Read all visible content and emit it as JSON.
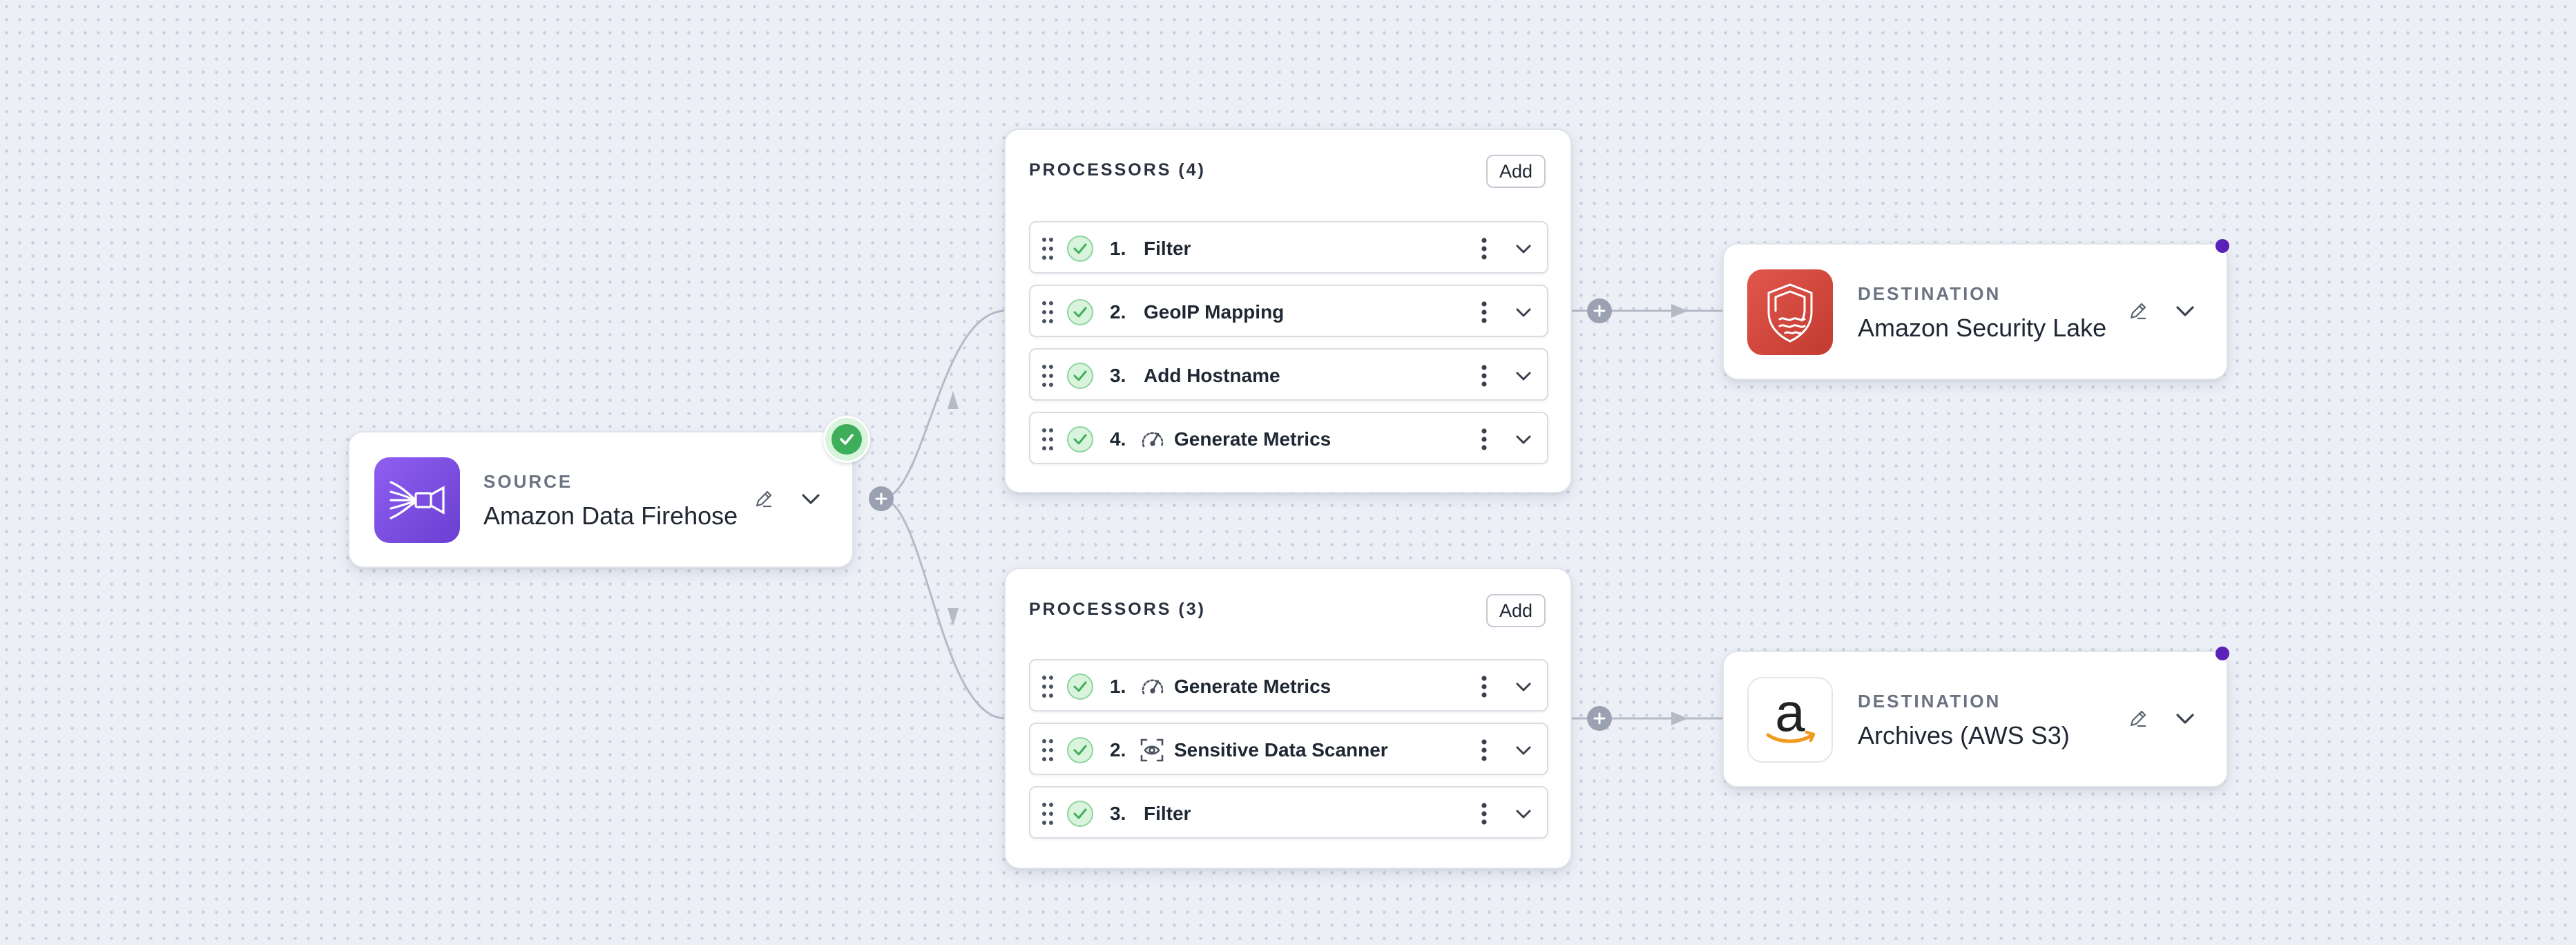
{
  "source": {
    "kicker": "SOURCE",
    "name": "Amazon Data Firehose",
    "icon": "firehose-icon",
    "icon_color": "#7c4ddb"
  },
  "processor_groups": [
    {
      "title": "PROCESSORS (4)",
      "add_label": "Add",
      "items": [
        {
          "num": "1.",
          "label": "Filter",
          "icon": ""
        },
        {
          "num": "2.",
          "label": "GeoIP Mapping",
          "icon": ""
        },
        {
          "num": "3.",
          "label": "Add Hostname",
          "icon": ""
        },
        {
          "num": "4.",
          "label": "Generate Metrics",
          "icon": "gauge-icon"
        }
      ]
    },
    {
      "title": "PROCESSORS (3)",
      "add_label": "Add",
      "items": [
        {
          "num": "1.",
          "label": "Generate Metrics",
          "icon": "gauge-icon"
        },
        {
          "num": "2.",
          "label": "Sensitive Data Scanner",
          "icon": "scanner-icon"
        },
        {
          "num": "3.",
          "label": "Filter",
          "icon": ""
        }
      ]
    }
  ],
  "destinations": [
    {
      "kicker": "DESTINATION",
      "name": "Amazon Security Lake",
      "icon": "security-lake-icon",
      "icon_color": "#d6443a"
    },
    {
      "kicker": "DESTINATION",
      "name": "Archives (AWS S3)",
      "icon": "amazon-logo-icon",
      "icon_color": "#ffffff"
    }
  ],
  "colors": {
    "status_ok": "#3fae5a",
    "connector": "#b4bac6",
    "accent_dot": "#5b21b6"
  }
}
